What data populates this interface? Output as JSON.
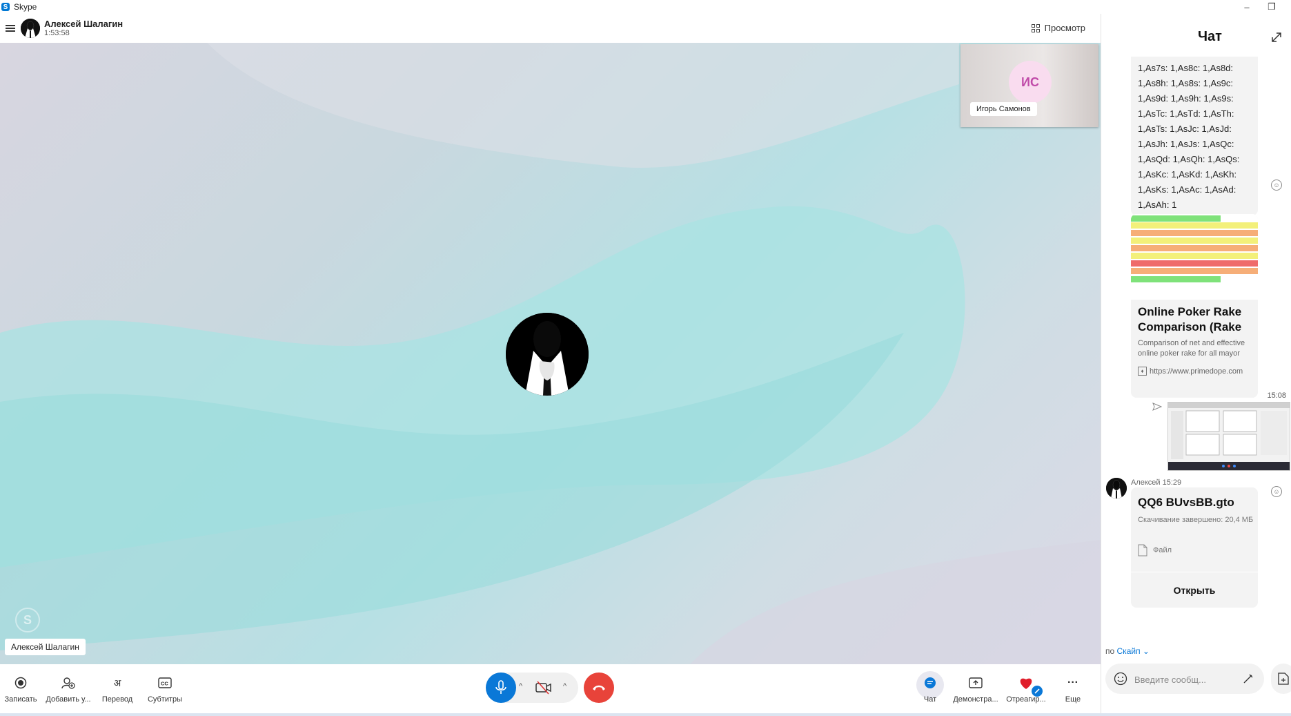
{
  "window": {
    "title": "Skype",
    "app_logo": "S",
    "minimize": "–",
    "restore": "❐"
  },
  "header": {
    "caller_name": "Алексей Шалагин",
    "call_duration": "1:53:58",
    "view_label": "Просмотр"
  },
  "stage": {
    "preview": {
      "initials": "ИС",
      "name": "Игорь Самонов"
    },
    "participant_name": "Алексей Шалагин",
    "watermark": "S"
  },
  "toolbar": {
    "record_label": "Записать",
    "add_label": "Добавить у...",
    "translate_label": "Перевод",
    "subtitles_label": "Субтитры",
    "chat_label": "Чат",
    "share_label": "Демонстра...",
    "react_label": "Отреагир...",
    "more_label": "Еще",
    "caret": "^",
    "accent_color": "#0a78d7",
    "hangup_color": "#e8433a"
  },
  "chat": {
    "title": "Чат",
    "text_lines": [
      "1,As7s: 1,As8c: 1,As8d:",
      "1,As8h: 1,As8s: 1,As9c:",
      "1,As9d: 1,As9h: 1,As9s:",
      "1,AsTc: 1,AsTd: 1,AsTh:",
      "1,AsTs: 1,AsJc: 1,AsJd:",
      "1,AsJh: 1,AsJs: 1,AsQc:",
      "1,AsQd: 1,AsQh: 1,AsQs:",
      "1,AsKc: 1,AsKd: 1,AsKh:",
      "1,AsKs: 1,AsAc: 1,AsAd:",
      "1,AsAh: 1"
    ],
    "link": {
      "title": "Online Poker Rake Comparison (Rake",
      "description": "Comparison of net and effective online poker rake for all mayor",
      "url": "https://www.primedope.com"
    },
    "sent_time": "15:08",
    "author_line": "Алексей 15:29",
    "file": {
      "name": "QQ6 BUvsBB.gto",
      "status": "Скачивание завершено: 20,4 МБ",
      "type": "Файл",
      "open_label": "Открыть"
    },
    "by_prefix": "по",
    "by_link": "Скайп",
    "compose_placeholder": "Введите сообщ..."
  }
}
